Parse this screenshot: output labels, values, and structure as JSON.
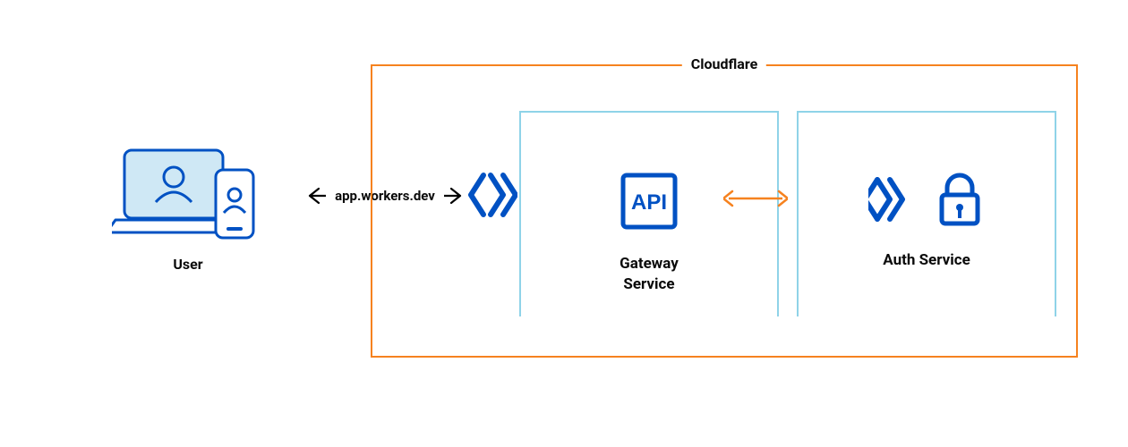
{
  "user": {
    "label": "User"
  },
  "connection": {
    "label": "app.workers.dev"
  },
  "container": {
    "title": "Cloudflare",
    "border_color": "#f6821f",
    "inner_border_color": "#8fd3e8"
  },
  "services": {
    "gateway": {
      "label": "Gateway\nService",
      "icon": "api-box",
      "api_text": "API"
    },
    "auth": {
      "label": "Auth Service",
      "icon": "lock"
    }
  },
  "colors": {
    "blue": "#0051c3",
    "light_blue": "#cfe8f5",
    "orange": "#f6821f",
    "black": "#000000"
  }
}
